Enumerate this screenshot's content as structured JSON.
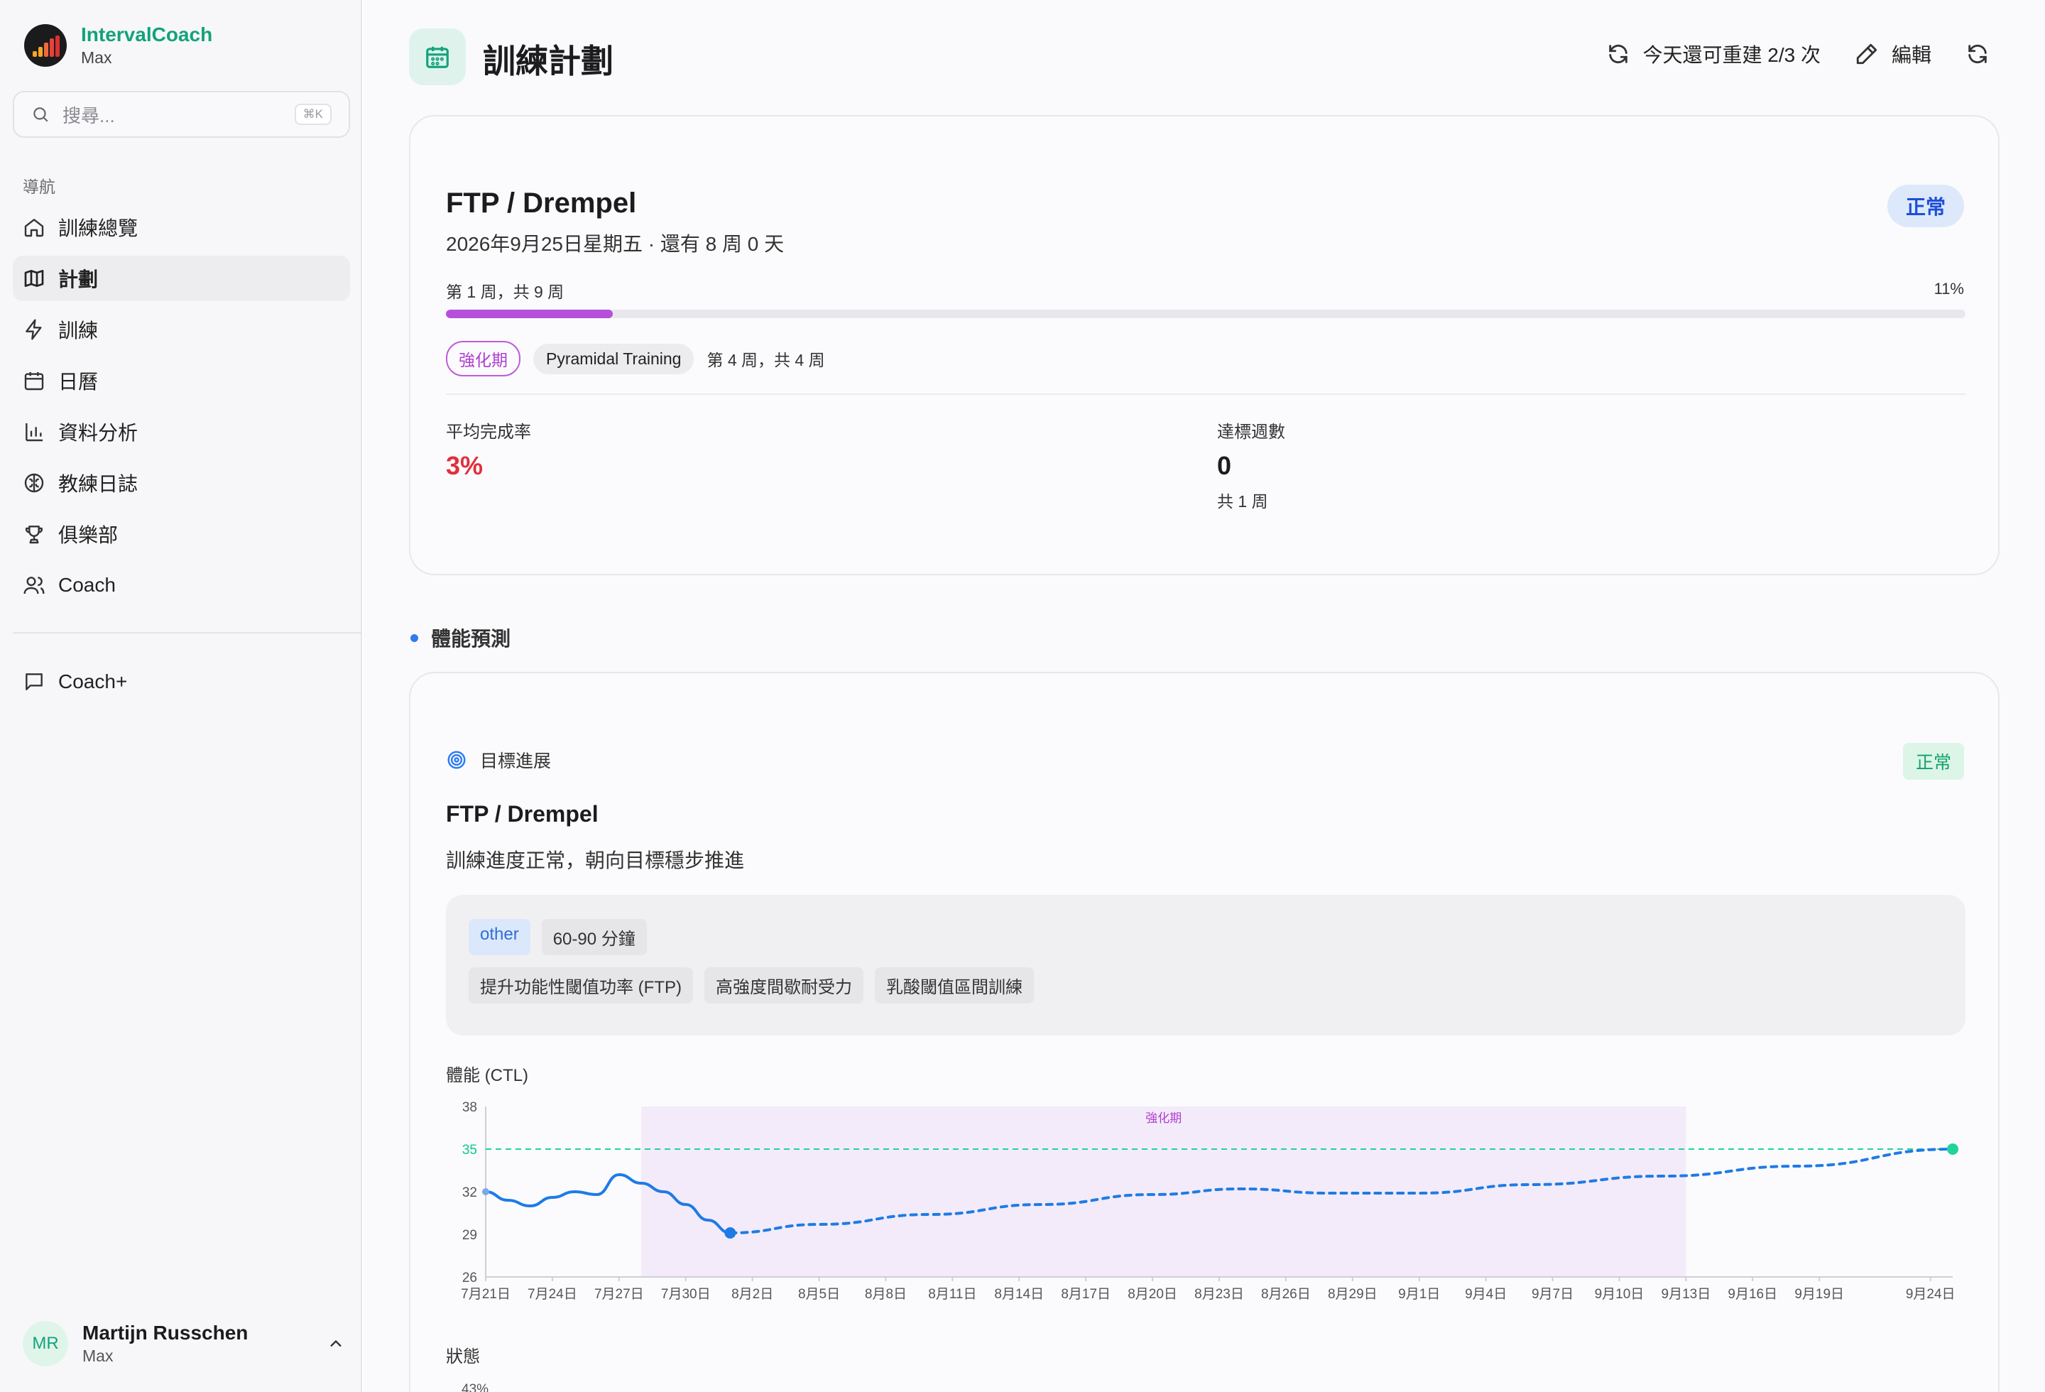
{
  "app": {
    "name": "IntervalCoach",
    "user": "Max"
  },
  "search": {
    "placeholder": "搜尋...",
    "shortcut": "⌘K"
  },
  "nav": {
    "heading": "導航",
    "items": [
      {
        "label": "訓練總覽",
        "icon": "home-icon"
      },
      {
        "label": "計劃",
        "icon": "map-icon",
        "active": true
      },
      {
        "label": "訓練",
        "icon": "zap-icon"
      },
      {
        "label": "日曆",
        "icon": "calendar-icon"
      },
      {
        "label": "資料分析",
        "icon": "bar-chart-icon"
      },
      {
        "label": "教練日誌",
        "icon": "brain-icon"
      },
      {
        "label": "俱樂部",
        "icon": "trophy-icon"
      },
      {
        "label": "Coach",
        "icon": "users-icon"
      }
    ],
    "coach_plus": "Coach+"
  },
  "user_footer": {
    "initials": "MR",
    "name": "Martijn Russchen",
    "sub": "Max"
  },
  "header": {
    "title": "訓練計劃",
    "rebuild": "今天還可重建 2/3 次",
    "edit": "編輯"
  },
  "plan": {
    "goal_title": "FTP / Drempel",
    "goal_date": "2026年9月25日星期五 · 還有 8 周 0 天",
    "status": "正常",
    "week_label": "第 1 周，共 9 周",
    "progress_label": "11%",
    "progress": 0.11,
    "phase": "強化期",
    "training_type": "Pyramidal Training",
    "phase_week": "第 4 周，共 4 周",
    "avg_completion_label": "平均完成率",
    "avg_completion": "3%",
    "weeks_met_label": "達標週數",
    "weeks_met": "0",
    "weeks_total": "共 1 周"
  },
  "forecast": {
    "section_title": "體能預測",
    "goal_progress_label": "目標進展",
    "status": "正常",
    "goal_title": "FTP / Drempel",
    "description": "訓練進度正常，朝向目標穩步推進",
    "chips_row1": [
      "other",
      "60-90 分鐘"
    ],
    "chips_row2": [
      "提升功能性閾值功率 (FTP)",
      "高強度間歇耐受力",
      "乳酸閾值區間訓練"
    ],
    "ctl_label": "體能 (CTL)",
    "state_label": "狀態",
    "state_first_tick": "43%"
  },
  "chart_data": {
    "type": "line",
    "ylabel": "體能 (CTL)",
    "ylim": [
      26,
      38
    ],
    "yticks": [
      26,
      29,
      32,
      35,
      38
    ],
    "target_value": 35,
    "target_label": "35",
    "phase_band": {
      "label": "強化期",
      "start": "2025-07-28",
      "end": "2025-09-13"
    },
    "xticks": [
      "7月21日",
      "7月24日",
      "7月27日",
      "7月30日",
      "8月2日",
      "8月5日",
      "8月8日",
      "8月11日",
      "8月14日",
      "8月17日",
      "8月20日",
      "8月23日",
      "8月26日",
      "8月29日",
      "9月1日",
      "9月4日",
      "9月7日",
      "9月10日",
      "9月13日",
      "9月16日",
      "9月19日",
      "9月24日"
    ],
    "xtick_dates": [
      "2025-07-21",
      "2025-07-24",
      "2025-07-27",
      "2025-07-30",
      "2025-08-02",
      "2025-08-05",
      "2025-08-08",
      "2025-08-11",
      "2025-08-14",
      "2025-08-17",
      "2025-08-20",
      "2025-08-23",
      "2025-08-26",
      "2025-08-29",
      "2025-09-01",
      "2025-09-04",
      "2025-09-07",
      "2025-09-10",
      "2025-09-13",
      "2025-09-16",
      "2025-09-19",
      "2025-09-24"
    ],
    "x_range": [
      "2025-07-21",
      "2025-09-25"
    ],
    "series": [
      {
        "kind": "actual",
        "color": "#1e7be6",
        "points": [
          [
            "2025-07-21",
            32.0
          ],
          [
            "2025-07-22",
            31.4
          ],
          [
            "2025-07-23",
            31.0
          ],
          [
            "2025-07-24",
            31.6
          ],
          [
            "2025-07-25",
            32.0
          ],
          [
            "2025-07-26",
            31.8
          ],
          [
            "2025-07-27",
            33.2
          ],
          [
            "2025-07-28",
            32.6
          ],
          [
            "2025-07-29",
            32.0
          ],
          [
            "2025-07-30",
            31.1
          ],
          [
            "2025-07-31",
            30.0
          ],
          [
            "2025-08-01",
            29.1
          ]
        ]
      },
      {
        "kind": "projected",
        "color": "#1e7be6",
        "points": [
          [
            "2025-08-01",
            29.1
          ],
          [
            "2025-08-05",
            29.7
          ],
          [
            "2025-08-10",
            30.4
          ],
          [
            "2025-08-15",
            31.1
          ],
          [
            "2025-08-20",
            31.8
          ],
          [
            "2025-08-24",
            32.2
          ],
          [
            "2025-08-28",
            31.9
          ],
          [
            "2025-09-01",
            31.9
          ],
          [
            "2025-09-06",
            32.5
          ],
          [
            "2025-09-12",
            33.1
          ],
          [
            "2025-09-18",
            33.8
          ],
          [
            "2025-09-25",
            35.0
          ]
        ]
      }
    ],
    "end_point": [
      "2025-09-25",
      35.0
    ],
    "colors": {
      "phase_band": "#f3ebf9",
      "phase_text": "#b03fd1",
      "target": "#1ed49b"
    }
  }
}
